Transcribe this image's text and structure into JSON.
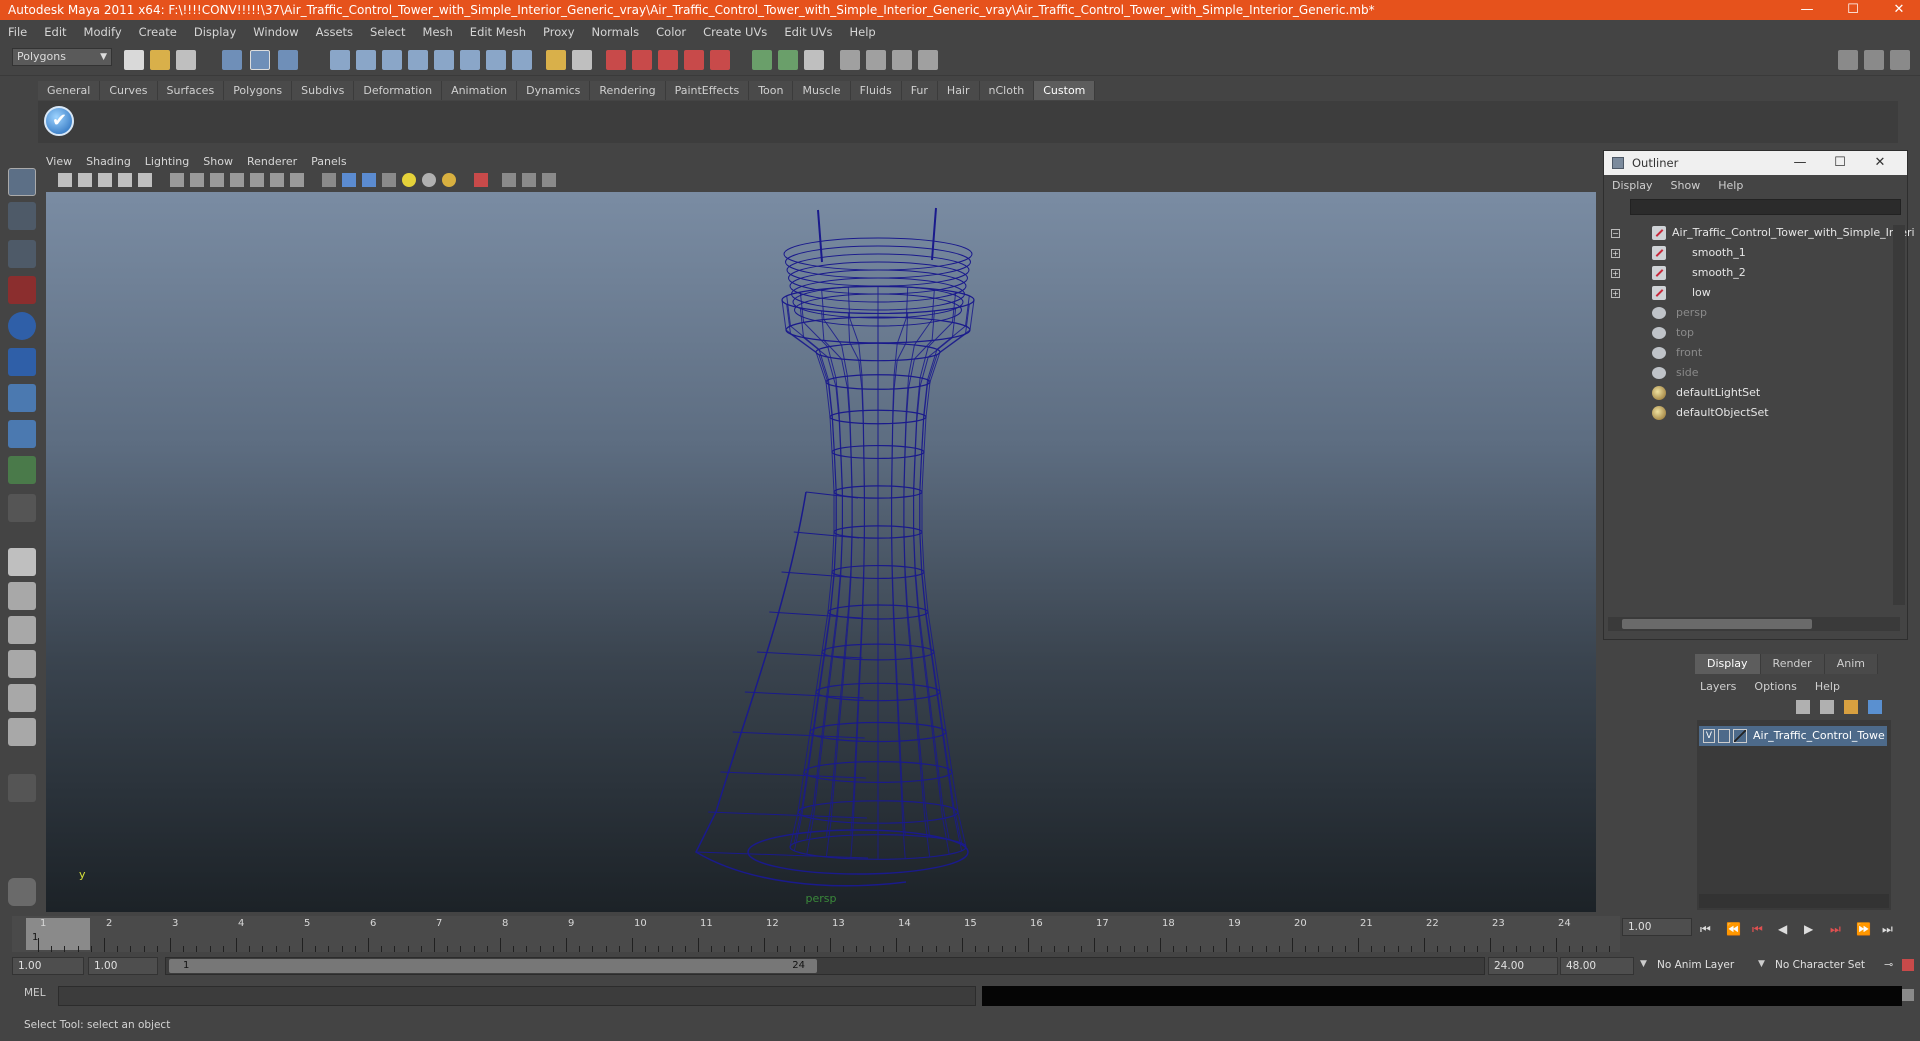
{
  "window": {
    "title": "Autodesk Maya 2011 x64: F:\\!!!!CONV!!!!!\\37\\Air_Traffic_Control_Tower_with_Simple_Interior_Generic_vray\\Air_Traffic_Control_Tower_with_Simple_Interior_Generic_vray\\Air_Traffic_Control_Tower_with_Simple_Interior_Generic.mb*",
    "accent": "#e6521c"
  },
  "menubar": [
    "File",
    "Edit",
    "Modify",
    "Create",
    "Display",
    "Window",
    "Assets",
    "Select",
    "Mesh",
    "Edit Mesh",
    "Proxy",
    "Normals",
    "Color",
    "Create UVs",
    "Edit UVs",
    "Help"
  ],
  "statusline": {
    "mode": "Polygons"
  },
  "shelf": {
    "tabs": [
      "General",
      "Curves",
      "Surfaces",
      "Polygons",
      "Subdivs",
      "Deformation",
      "Animation",
      "Dynamics",
      "Rendering",
      "PaintEffects",
      "Toon",
      "Muscle",
      "Fluids",
      "Fur",
      "Hair",
      "nCloth",
      "Custom"
    ],
    "active_tab": "Custom"
  },
  "viewport": {
    "menu": [
      "View",
      "Shading",
      "Lighting",
      "Show",
      "Renderer",
      "Panels"
    ],
    "camera": "persp",
    "axis_label": "y",
    "wireframe_color": "#1a1a8c"
  },
  "outliner": {
    "title": "Outliner",
    "menu": [
      "Display",
      "Show",
      "Help"
    ],
    "items": [
      {
        "label": "Air_Traffic_Control_Tower_with_Simple_Interi",
        "type": "mesh",
        "expand": "−"
      },
      {
        "label": "smooth_1",
        "type": "mesh",
        "expand": "+"
      },
      {
        "label": "smooth_2",
        "type": "mesh",
        "expand": "+"
      },
      {
        "label": "low",
        "type": "mesh",
        "expand": "+"
      },
      {
        "label": "persp",
        "type": "camera"
      },
      {
        "label": "top",
        "type": "camera"
      },
      {
        "label": "front",
        "type": "camera"
      },
      {
        "label": "side",
        "type": "camera"
      },
      {
        "label": "defaultLightSet",
        "type": "set"
      },
      {
        "label": "defaultObjectSet",
        "type": "set"
      }
    ]
  },
  "layer_editor": {
    "tabs": [
      "Display",
      "Render",
      "Anim"
    ],
    "active_tab": "Display",
    "menu": [
      "Layers",
      "Options",
      "Help"
    ],
    "layer": {
      "name": "Air_Traffic_Control_Tower_wi",
      "visible": "V"
    }
  },
  "timeslider": {
    "frames": [
      "1",
      "2",
      "3",
      "4",
      "5",
      "6",
      "7",
      "8",
      "9",
      "10",
      "11",
      "12",
      "13",
      "14",
      "15",
      "16",
      "17",
      "18",
      "19",
      "20",
      "21",
      "22",
      "23",
      "24"
    ],
    "current_frame": "1",
    "current_time_field": "1.00"
  },
  "rangeslider": {
    "start_time": "1.00",
    "playback_start": "1.00",
    "range_start_label": "1",
    "range_end_label": "24",
    "playback_end": "24.00",
    "end_time": "48.00",
    "anim_layer": "No Anim Layer",
    "character_set": "No Character Set"
  },
  "commandline": {
    "label": "MEL"
  },
  "helpline": {
    "text": "Select Tool: select an object"
  }
}
